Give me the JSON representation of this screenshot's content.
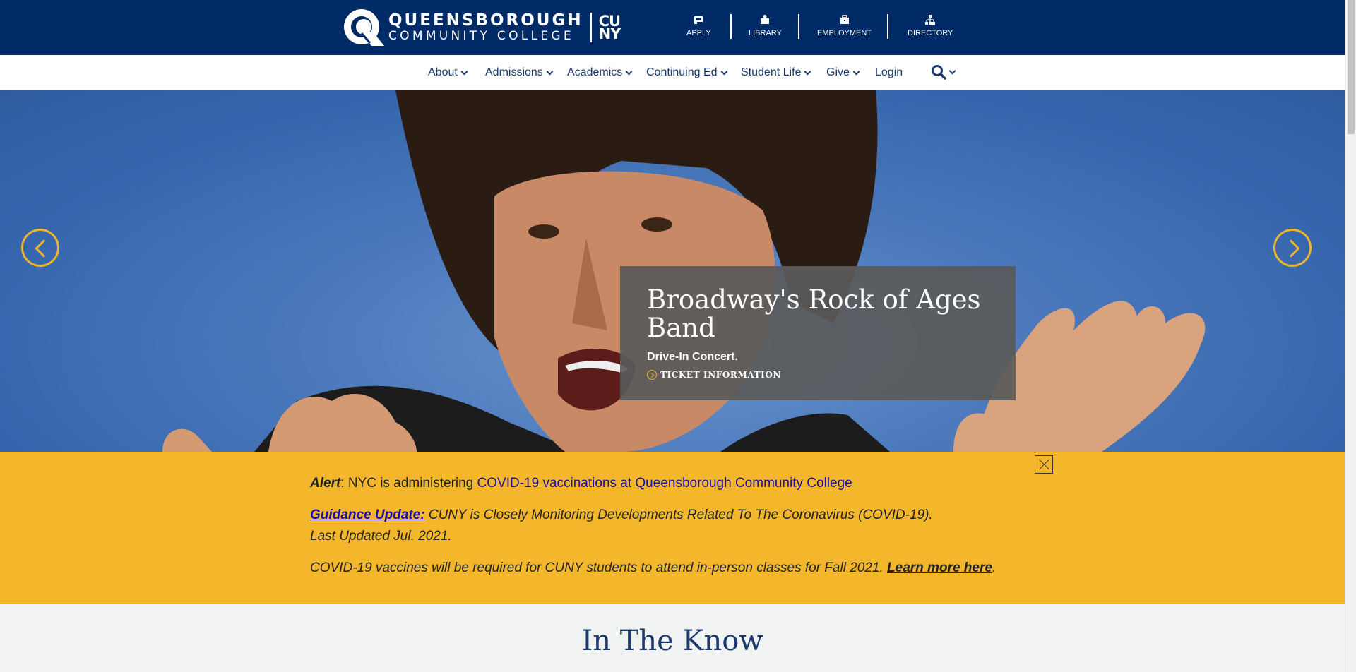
{
  "header": {
    "logo_line1": "QUEENSBOROUGH",
    "logo_line2": "COMMUNITY COLLEGE",
    "logo_cuny_top": "CU",
    "logo_cuny_bottom": "NY",
    "brand_color": "#002b66",
    "utility_links": [
      {
        "label": "APPLY",
        "icon": "apply-icon"
      },
      {
        "label": "LIBRARY",
        "icon": "library-icon"
      },
      {
        "label": "EMPLOYMENT",
        "icon": "briefcase-icon"
      },
      {
        "label": "DIRECTORY",
        "icon": "sitemap-icon"
      }
    ]
  },
  "nav": {
    "items": [
      {
        "label": "About"
      },
      {
        "label": "Admissions"
      },
      {
        "label": "Academics"
      },
      {
        "label": "Continuing Ed"
      },
      {
        "label": "Student Life"
      },
      {
        "label": "Give"
      },
      {
        "label": "Login"
      }
    ],
    "search_icon": "search-icon"
  },
  "hero": {
    "title": "Broadway's Rock of Ages Band",
    "subtitle": "Drive-In Concert.",
    "link_label": "TICKET INFORMATION",
    "accent_color": "#f0b429"
  },
  "alert": {
    "line1_prefix": "Alert",
    "line1_text": ": NYC is administering ",
    "line1_link": "COVID-19 vaccinations at Queensborough Community College",
    "line2_link": "Guidance Update:",
    "line2_text": " CUNY is Closely Monitoring Developments Related To The Coronavirus (COVID-19).",
    "line2_updated": "Last Updated Jul. 2021.",
    "line3_text": "COVID-19 vaccines will be required for CUNY students to attend in-person classes for Fall 2021. ",
    "line3_link": "Learn more here",
    "line3_end": ".",
    "background": "#f4b72b"
  },
  "section": {
    "title": "In The Know"
  }
}
